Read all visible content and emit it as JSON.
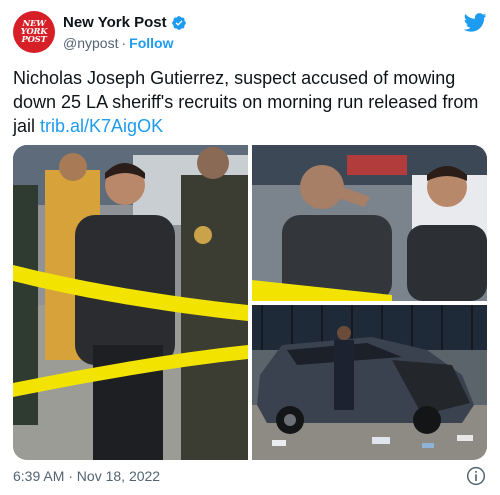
{
  "account": {
    "avatar_lines": [
      "NEW",
      "YORK",
      "POST"
    ],
    "name": "New York Post",
    "handle": "@nypost",
    "separator": "·",
    "follow_label": "Follow"
  },
  "tweet": {
    "text": "Nicholas Joseph Gutierrez, suspect accused of mowing down 25 LA sheriff's recruits on morning run released from jail ",
    "link": "trib.al/K7AigOK"
  },
  "footer": {
    "timestamp": "6:39 AM · Nov 18, 2022"
  },
  "colors": {
    "accent": "#1d9bf0",
    "avatar_bg": "#d61f26",
    "text_primary": "#0f1419",
    "text_secondary": "#536471"
  },
  "icons": [
    "verified-badge-icon",
    "twitter-bird-icon",
    "info-icon"
  ]
}
